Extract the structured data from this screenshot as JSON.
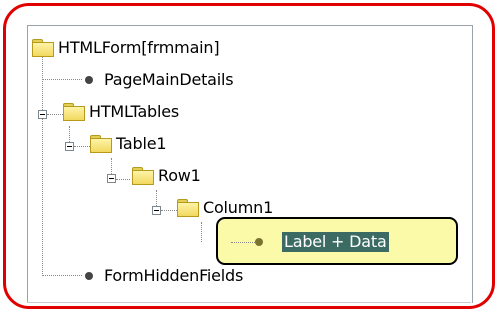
{
  "tree": {
    "root": {
      "label": "HTMLForm[frmmain]",
      "icon": "folder-icon"
    },
    "nodes": [
      {
        "label": "PageMainDetails",
        "icon": "leaf-dot-icon"
      },
      {
        "label": "HTMLTables",
        "icon": "folder-icon",
        "expanded": true
      },
      {
        "label": "Table1",
        "icon": "folder-icon",
        "expanded": true
      },
      {
        "label": "Row1",
        "icon": "folder-icon",
        "expanded": true
      },
      {
        "label": "Column1",
        "icon": "folder-icon",
        "expanded": true
      },
      {
        "label": "Label + Data",
        "icon": "leaf-dot-icon",
        "selected": true
      },
      {
        "label": "FormHiddenFields",
        "icon": "leaf-dot-icon"
      }
    ]
  },
  "colors": {
    "frame_border": "#e00000",
    "highlight_fill": "#fafaa8",
    "selection_bg": "#3b6b62"
  }
}
